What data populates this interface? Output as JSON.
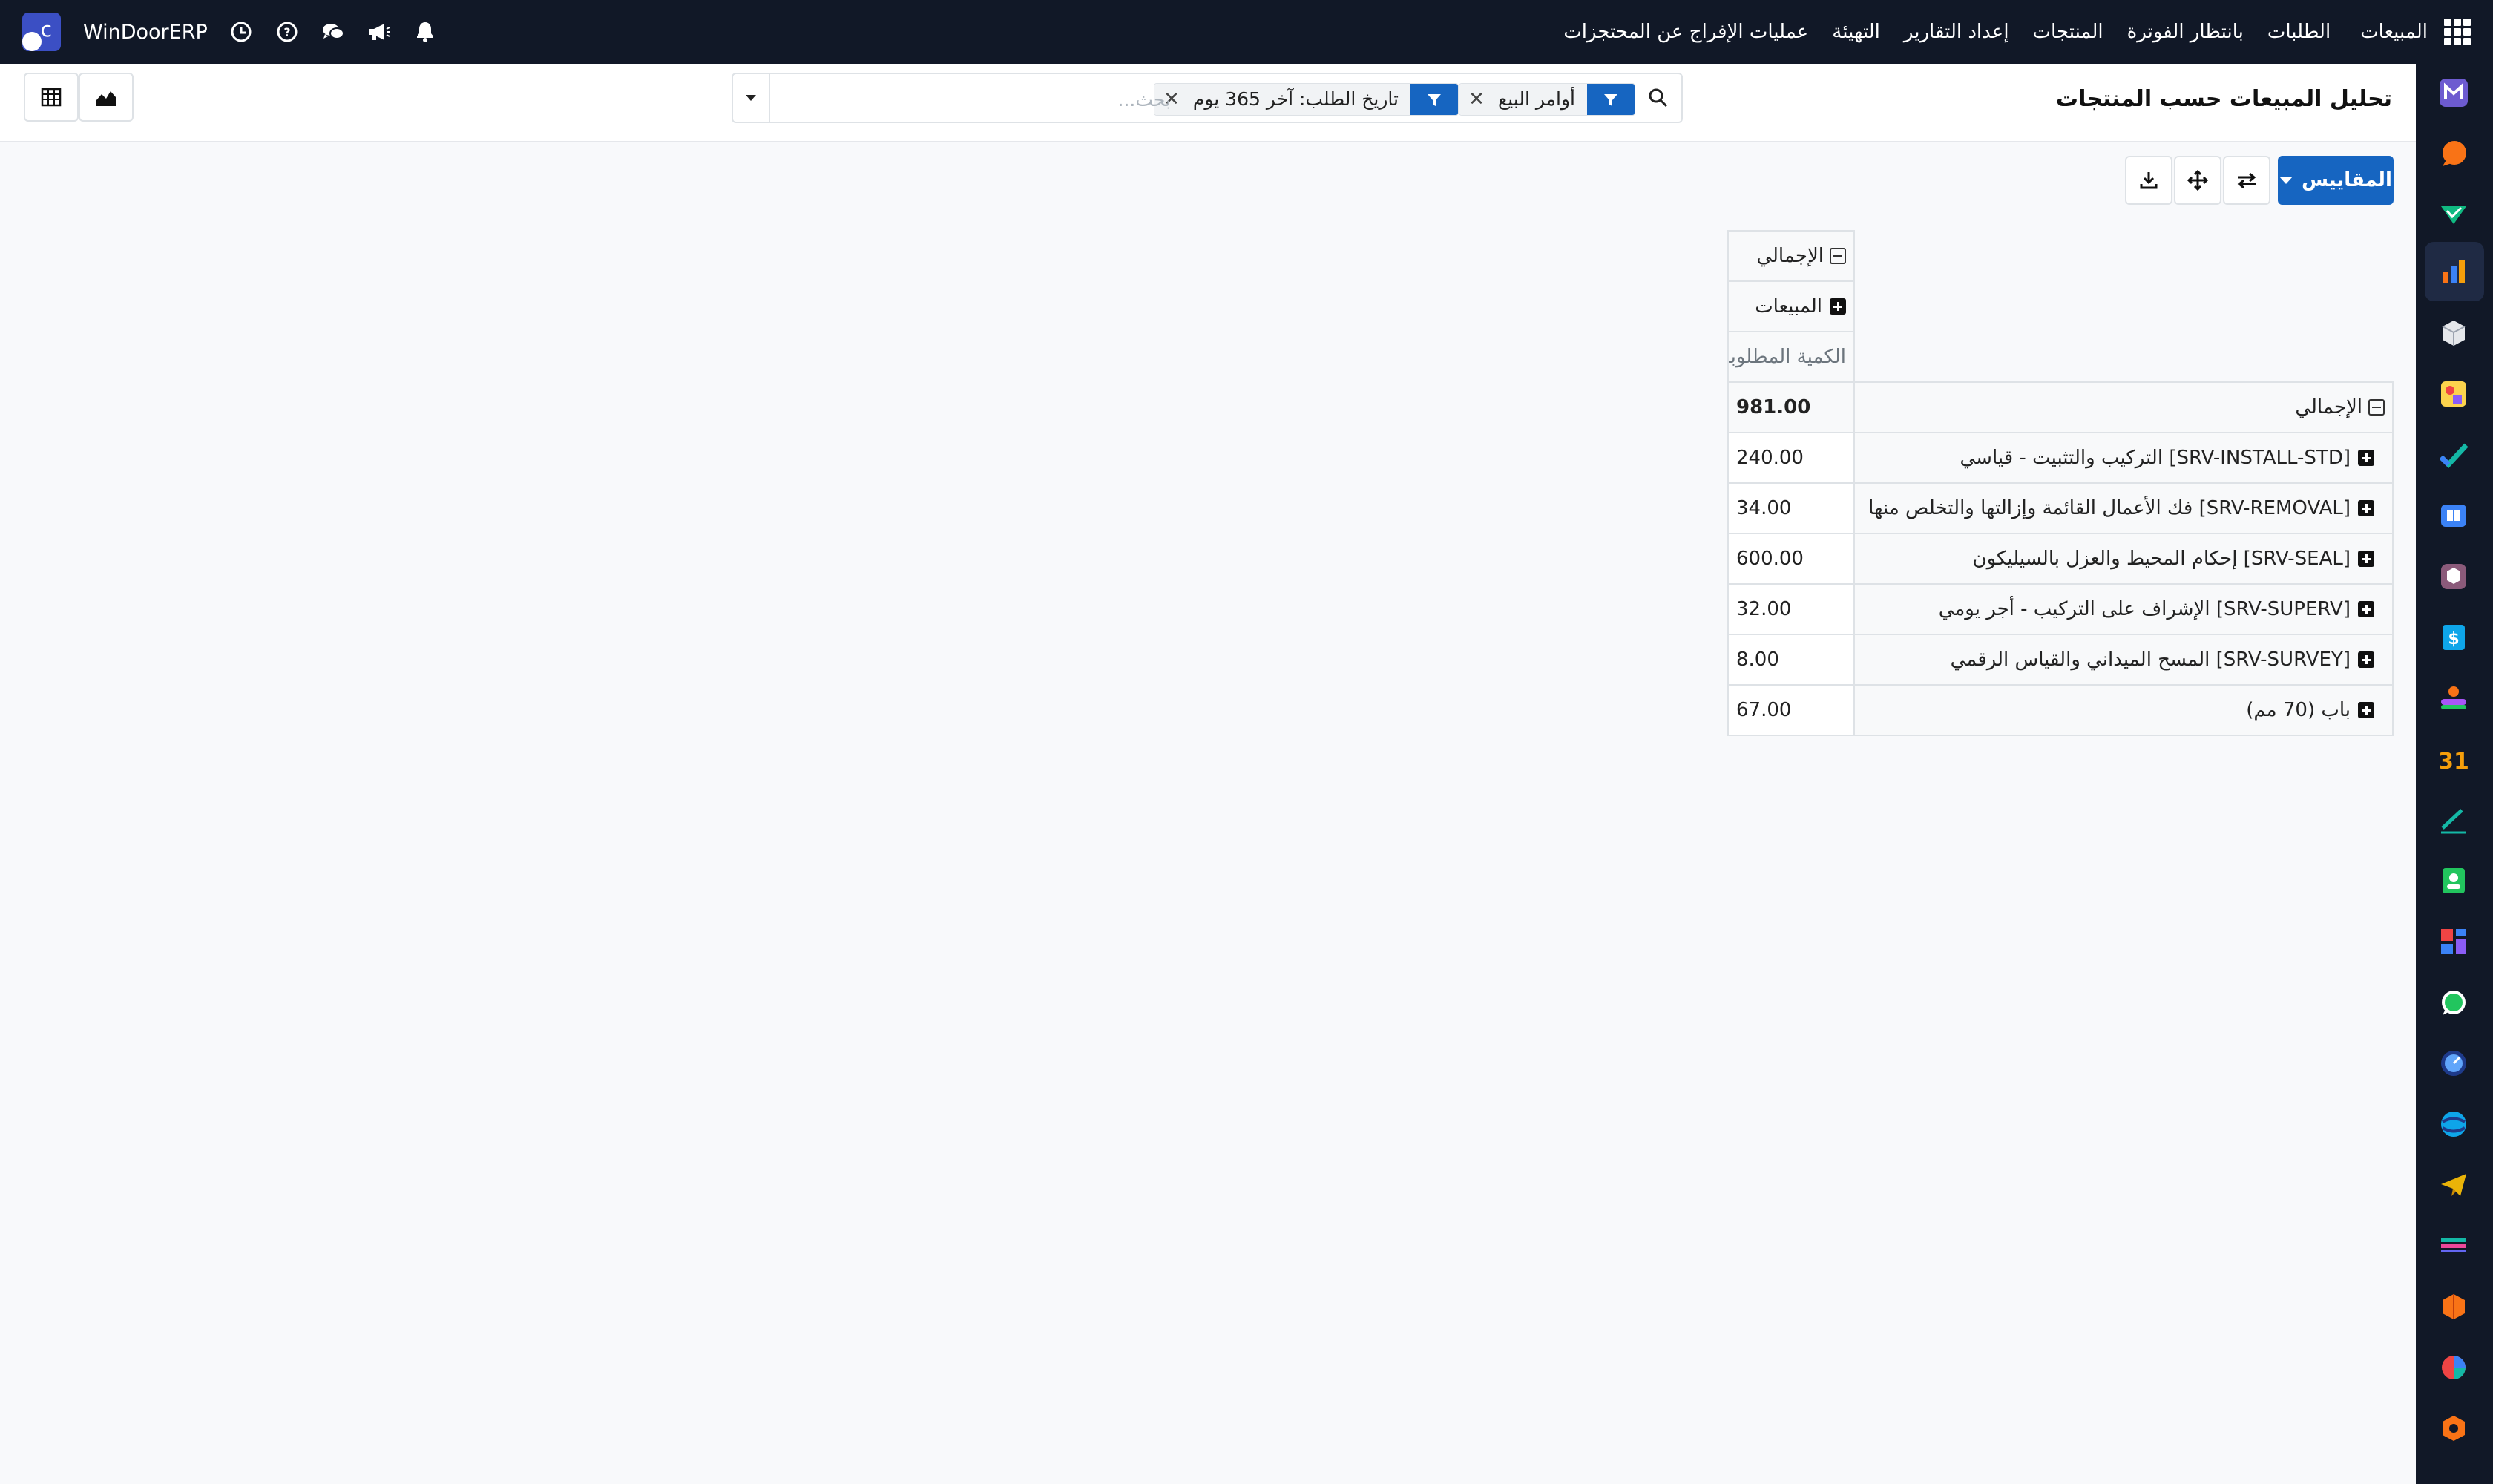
{
  "brand": "WinDoorERP",
  "nav": {
    "items": [
      "المبيعات",
      "الطلبات",
      "بانتظار الفوترة",
      "المنتجات",
      "إعداد التقارير",
      "التهيئة",
      "عمليات الإفراج عن المحتجزات"
    ]
  },
  "page": {
    "title": "تحليل المبيعات حسب المنتجات"
  },
  "search": {
    "placeholder": "بحث...",
    "facets": [
      "أوامر البيع",
      "تاريخ الطلب: آخر 365 يوم"
    ]
  },
  "toolbar": {
    "measures_label": "المقاييس"
  },
  "pivot": {
    "col_header_total": "الإجمالي",
    "col_group": "المبيعات",
    "measure": "الكمية المطلوبة",
    "row_header_total": "الإجمالي",
    "total_value": "981.00",
    "rows": [
      {
        "label": "[SRV-INSTALL-STD] التركيب والتثبيت - قياسي",
        "value": "240.00"
      },
      {
        "label": "[SRV-REMOVAL] فك الأعمال القائمة وإزالتها والتخلص منها",
        "value": "34.00"
      },
      {
        "label": "[SRV-SEAL] إحكام المحيط والعزل بالسيليكون",
        "value": "600.00"
      },
      {
        "label": "[SRV-SUPERV] الإشراف على التركيب - أجر يومي",
        "value": "32.00"
      },
      {
        "label": "[SRV-SURVEY] المسح الميداني والقياس الرقمي",
        "value": "8.00"
      },
      {
        "label": "باب (70 مم)",
        "value": "67.00"
      }
    ]
  },
  "sidebar_icons": [
    "mail-app-icon",
    "chat-app-icon",
    "check-app-icon",
    "reporting-app-icon",
    "inventory-app-icon",
    "contacts-app-icon",
    "todo-app-icon",
    "knowledge-app-icon",
    "repair-app-icon",
    "invoicing-app-icon",
    "employees-app-icon",
    "calendar-app-icon",
    "sign-app-icon",
    "contacts-card-app-icon",
    "dashboard-app-icon",
    "whatsapp-app-icon",
    "timesheet-app-icon",
    "discuss-app-icon",
    "telegram-app-icon",
    "accounting-app-icon",
    "apps-store-icon",
    "pie-app-icon",
    "module-app-icon"
  ],
  "colors": {
    "navbar": "#111827",
    "primary": "#1665c1"
  }
}
